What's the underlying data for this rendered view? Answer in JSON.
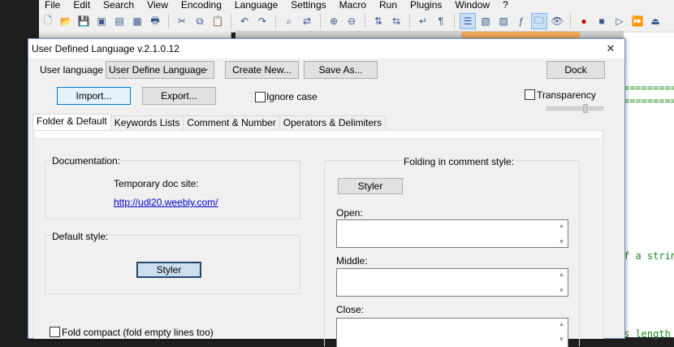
{
  "app": {
    "menu": [
      "File",
      "Edit",
      "Search",
      "View",
      "Encoding",
      "Language",
      "Settings",
      "Macro",
      "Run",
      "Plugins",
      "Window",
      "?"
    ],
    "editor_visible_text": [
      "=========",
      "=========",
      "f a strin",
      "s length"
    ]
  },
  "dialog": {
    "title": "User Defined Language v.2.1.0.12",
    "close_label": "✕",
    "user_language_label": "User language :",
    "user_language_value": "User Define Language",
    "create_new_label": "Create New...",
    "save_as_label": "Save As...",
    "dock_label": "Dock",
    "import_label": "Import...",
    "export_label": "Export...",
    "ignore_case_label": "Ignore case",
    "ignore_case_checked": false,
    "transparency_label": "Transparency",
    "transparency_checked": false,
    "tabs": [
      {
        "label": "Folder & Default",
        "active": true
      },
      {
        "label": "Keywords Lists",
        "active": false
      },
      {
        "label": "Comment & Number",
        "active": false
      },
      {
        "label": "Operators & Delimiters",
        "active": false
      }
    ],
    "documentation": {
      "heading": "Documentation:",
      "temp_site_label": "Temporary doc site:",
      "link": "http://udl20.weebly.com/"
    },
    "default_style": {
      "heading": "Default style:",
      "styler_label": "Styler"
    },
    "folding_comment": {
      "heading": "Folding in comment style:",
      "styler_label": "Styler",
      "open_label": "Open:",
      "open_value": "",
      "middle_label": "Middle:",
      "middle_value": "",
      "close_label": "Close:",
      "close_value": ""
    },
    "fold_compact_label": "Fold compact (fold empty lines too)",
    "fold_compact_checked": false
  },
  "colors": {
    "focus_border": "#0078d7",
    "styler_border": "#26466d",
    "link": "#0000cc",
    "editor_green": "#1a8a1a"
  }
}
